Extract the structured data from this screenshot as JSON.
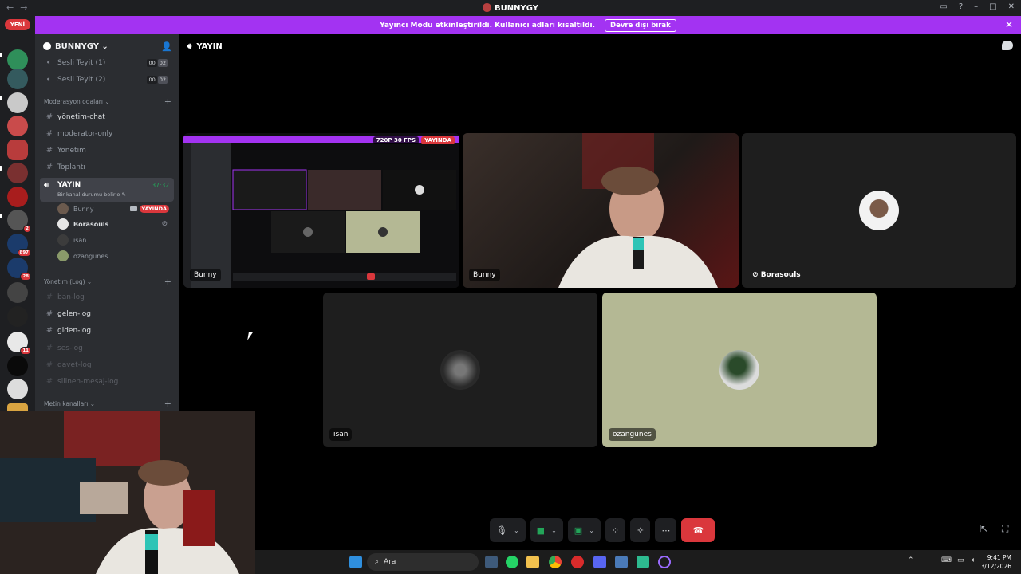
{
  "window": {
    "title": "BUNNYGY",
    "nav_back": "←",
    "nav_fwd": "→",
    "min": "–",
    "max": "□",
    "close": "✕"
  },
  "banner": {
    "text": "Yayıncı Modu etkinleştirildi. Kullanıcı adları kısaltıldı.",
    "button": "Devre dışı bırak",
    "close": "✕"
  },
  "guilds": {
    "new_pill": "YENİ",
    "badges": [
      "2",
      "897",
      "28",
      "11"
    ]
  },
  "server": {
    "name": "BUNNYGY ⌄"
  },
  "channels": {
    "sesli1": {
      "name": "Sesli Teyit (1)",
      "a": "00",
      "b": "02"
    },
    "sesli2": {
      "name": "Sesli Teyit (2)",
      "a": "00",
      "b": "02"
    },
    "cat_mod": "Moderasyon odaları ⌄",
    "yonetim_chat": "yönetim-chat",
    "moderator_only": "moderator-only",
    "yonetim": "Yönetim",
    "toplanti": "Toplantı",
    "active": {
      "name": "YAYIN",
      "sub": "Bir kanal durumu belirle ✎",
      "time": "37:32"
    },
    "users": [
      {
        "name": "Bunny",
        "badge": "YAYINDA"
      },
      {
        "name": "Borasouls"
      },
      {
        "name": "isan"
      },
      {
        "name": "ozangunes"
      }
    ],
    "cat_log": "Yönetim (Log) ⌄",
    "ban_log": "ban-log",
    "gelen_log": "gelen-log",
    "giden_log": "giden-log",
    "ses_log": "ses-log",
    "davet_log": "davet-log",
    "silinen_log": "silinen-mesaj-log",
    "cat_text": "Metin kanalları ⌄"
  },
  "header": {
    "channel": "YAYIN"
  },
  "tiles": {
    "stream": {
      "label": "Bunny",
      "quality": "720P 30 FPS",
      "live": "YAYINDA"
    },
    "bunny": {
      "label": "Bunny"
    },
    "borasouls": {
      "label": "Borasouls"
    },
    "isan": {
      "label": "isan"
    },
    "ozangunes": {
      "label": "ozangunes"
    }
  },
  "taskbar": {
    "search": "Ara",
    "time": "9:41 PM",
    "date": "3/12/2026"
  },
  "colors": {
    "accent": "#a333f2",
    "live": "#da373c",
    "online": "#23a559",
    "ozan_bg": "#b4b894"
  }
}
